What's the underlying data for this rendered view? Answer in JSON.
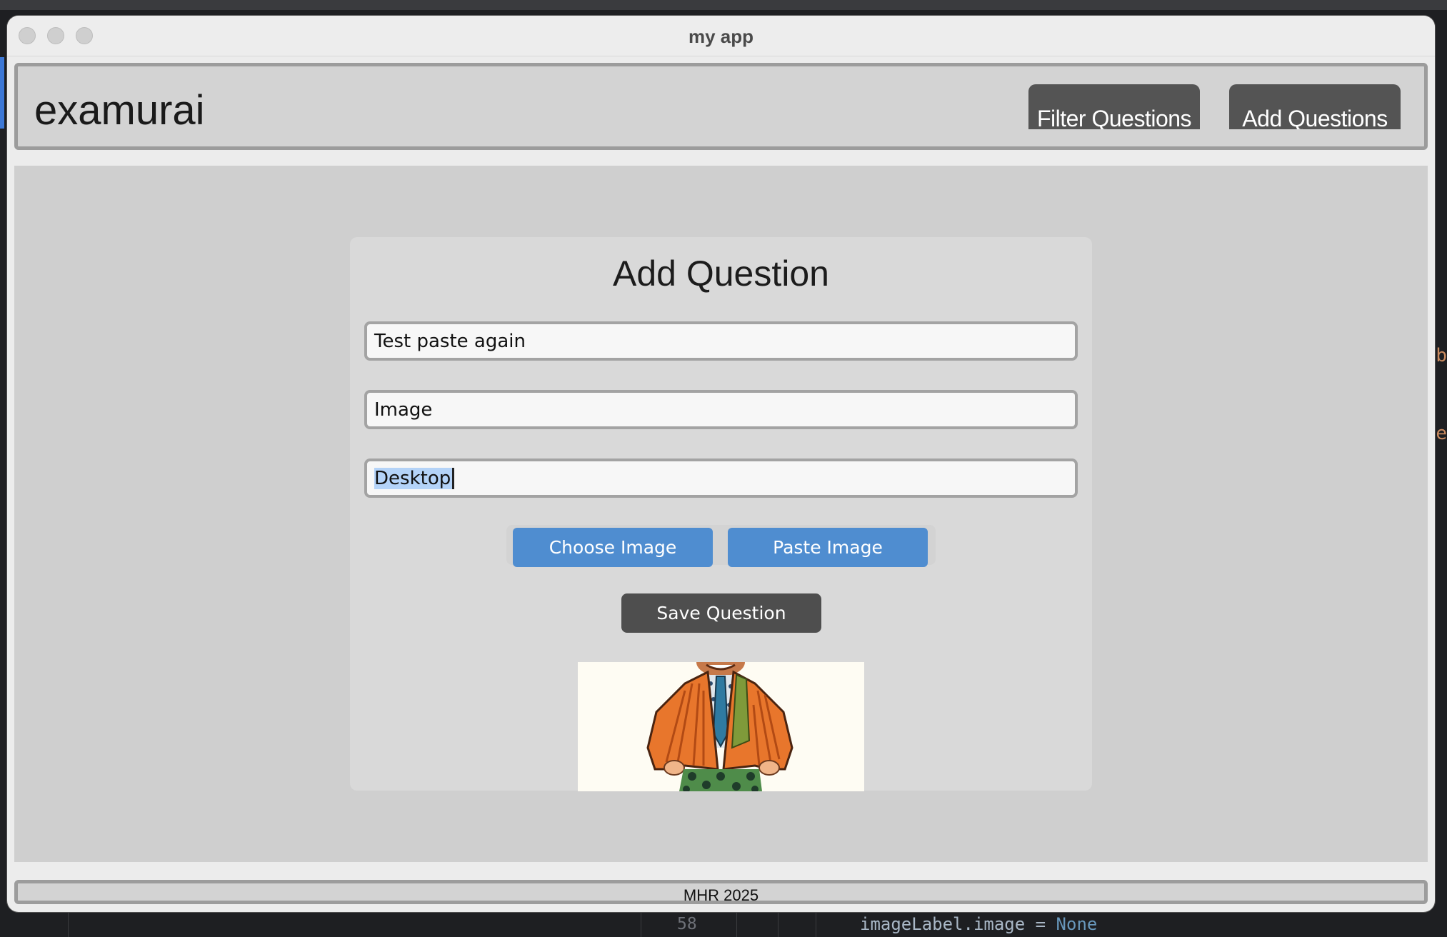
{
  "window": {
    "title": "my app"
  },
  "header": {
    "brand": "examurai",
    "nav": {
      "filter_label": "Filter Questions",
      "add_label": "Add Questions"
    }
  },
  "form": {
    "title": "Add Question",
    "fields": [
      {
        "value": "Test paste again"
      },
      {
        "value": "Image"
      },
      {
        "value": "Desktop",
        "selected": true
      }
    ],
    "choose_image_label": "Choose Image",
    "paste_image_label": "Paste Image",
    "save_label": "Save Question",
    "preview_image": "cartoon-man-in-orange-striped-suit"
  },
  "footer": {
    "text": "MHR 2025"
  },
  "background_editor": {
    "line_number": "58",
    "code_var": "imageLabel",
    "code_op": ".image = ",
    "code_value": "None",
    "edge_chars": [
      "b",
      "e"
    ]
  },
  "colors": {
    "accent_blue": "#4f8dd0",
    "dark_button": "#4e4e4e",
    "nav_button": "#545454",
    "selection": "#b4d3f8"
  }
}
